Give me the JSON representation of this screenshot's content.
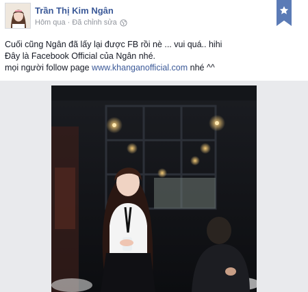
{
  "post": {
    "author_name": "Trần Thị Kim Ngân",
    "timestamp": "Hôm qua",
    "edited_label": "Đã chỉnh sửa",
    "meta_separator": "·",
    "lines": [
      "Cuối cũng Ngân đã lấy lại được FB rồi nè ... vui quá.. hihi",
      "Đây là Facebook Official của Ngân nhé."
    ],
    "line3_prefix": "mọi người follow page ",
    "link_text": "www.khanganofficial.com",
    "line3_suffix": " nhé ^^"
  },
  "icons": {
    "privacy": "globe-icon",
    "bookmark": "star-bookmark-icon"
  },
  "colors": {
    "link": "#3b5998",
    "meta": "#90949c",
    "bookmark": "#5b7bb6",
    "background_strip": "#e9eaed"
  }
}
